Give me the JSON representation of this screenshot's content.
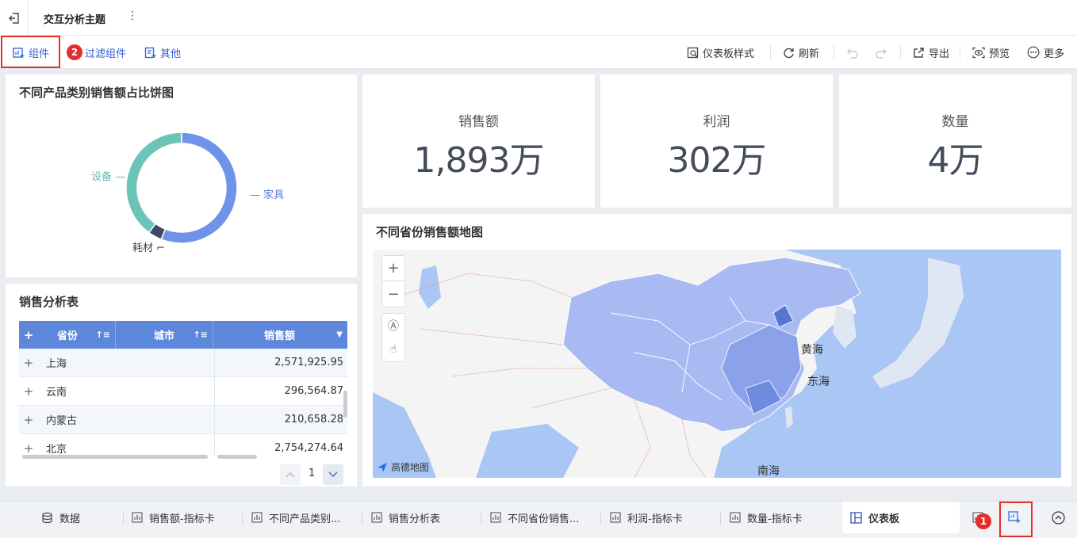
{
  "header": {
    "title": "交互分析主题"
  },
  "toolbar": {
    "left": [
      {
        "label": "组件"
      },
      {
        "label": "过滤组件"
      },
      {
        "label": "其他"
      }
    ],
    "right": [
      {
        "label": "仪表板样式"
      },
      {
        "label": "刷新"
      },
      {
        "label": "导出"
      },
      {
        "label": "预览"
      },
      {
        "label": "更多"
      }
    ]
  },
  "annotations": {
    "badge1": "1",
    "badge2": "2"
  },
  "pie_panel": {
    "title": "不同产品类别销售额占比饼图",
    "chart_data": {
      "type": "pie",
      "title": "不同产品类别销售额占比饼图",
      "slices": [
        {
          "label": "家具",
          "value": 56,
          "color": "#6f93e8"
        },
        {
          "label": "耗材",
          "value": 4,
          "color": "#3c4a68"
        },
        {
          "label": "设备",
          "value": 40,
          "color": "#6cc3b8"
        }
      ]
    }
  },
  "kpis": [
    {
      "label": "销售额",
      "value": "1,893万"
    },
    {
      "label": "利润",
      "value": "302万"
    },
    {
      "label": "数量",
      "value": "4万"
    }
  ],
  "table_panel": {
    "title": "销售分析表",
    "columns": [
      "省份",
      "城市",
      "销售额"
    ],
    "rows": [
      {
        "province": "上海",
        "sales": "2,571,925.95"
      },
      {
        "province": "云南",
        "sales": "296,564.87"
      },
      {
        "province": "内蒙古",
        "sales": "210,658.28"
      },
      {
        "province": "北京",
        "sales": "2,754,274.64"
      }
    ],
    "page": "1"
  },
  "map_panel": {
    "title": "不同省份销售额地图",
    "seas": [
      "黄海",
      "东海",
      "南海"
    ],
    "attribution": "高德地图"
  },
  "bottom_tabs": [
    {
      "label": "数据"
    },
    {
      "label": "销售额-指标卡"
    },
    {
      "label": "不同产品类别..."
    },
    {
      "label": "销售分析表"
    },
    {
      "label": "不同省份销售..."
    },
    {
      "label": "利润-指标卡"
    },
    {
      "label": "数量-指标卡"
    },
    {
      "label": "仪表板"
    }
  ],
  "colors": {
    "accent": "#2b5fd9",
    "highlight": "#e52d2d",
    "table_header": "#5d87da",
    "map_land": "#a9baf2"
  }
}
